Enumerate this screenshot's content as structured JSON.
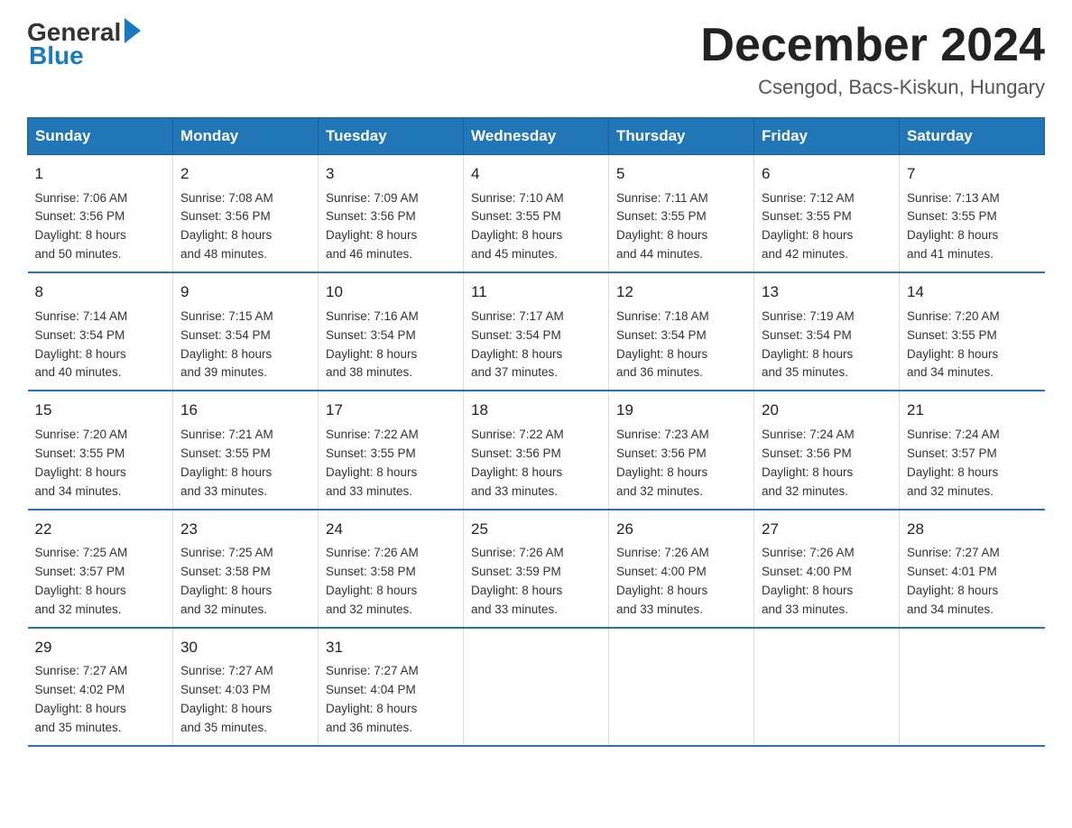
{
  "header": {
    "logo_general": "General",
    "logo_blue": "Blue",
    "main_title": "December 2024",
    "subtitle": "Csengod, Bacs-Kiskun, Hungary"
  },
  "days_of_week": [
    "Sunday",
    "Monday",
    "Tuesday",
    "Wednesday",
    "Thursday",
    "Friday",
    "Saturday"
  ],
  "weeks": [
    [
      {
        "day": "1",
        "info": "Sunrise: 7:06 AM\nSunset: 3:56 PM\nDaylight: 8 hours\nand 50 minutes."
      },
      {
        "day": "2",
        "info": "Sunrise: 7:08 AM\nSunset: 3:56 PM\nDaylight: 8 hours\nand 48 minutes."
      },
      {
        "day": "3",
        "info": "Sunrise: 7:09 AM\nSunset: 3:56 PM\nDaylight: 8 hours\nand 46 minutes."
      },
      {
        "day": "4",
        "info": "Sunrise: 7:10 AM\nSunset: 3:55 PM\nDaylight: 8 hours\nand 45 minutes."
      },
      {
        "day": "5",
        "info": "Sunrise: 7:11 AM\nSunset: 3:55 PM\nDaylight: 8 hours\nand 44 minutes."
      },
      {
        "day": "6",
        "info": "Sunrise: 7:12 AM\nSunset: 3:55 PM\nDaylight: 8 hours\nand 42 minutes."
      },
      {
        "day": "7",
        "info": "Sunrise: 7:13 AM\nSunset: 3:55 PM\nDaylight: 8 hours\nand 41 minutes."
      }
    ],
    [
      {
        "day": "8",
        "info": "Sunrise: 7:14 AM\nSunset: 3:54 PM\nDaylight: 8 hours\nand 40 minutes."
      },
      {
        "day": "9",
        "info": "Sunrise: 7:15 AM\nSunset: 3:54 PM\nDaylight: 8 hours\nand 39 minutes."
      },
      {
        "day": "10",
        "info": "Sunrise: 7:16 AM\nSunset: 3:54 PM\nDaylight: 8 hours\nand 38 minutes."
      },
      {
        "day": "11",
        "info": "Sunrise: 7:17 AM\nSunset: 3:54 PM\nDaylight: 8 hours\nand 37 minutes."
      },
      {
        "day": "12",
        "info": "Sunrise: 7:18 AM\nSunset: 3:54 PM\nDaylight: 8 hours\nand 36 minutes."
      },
      {
        "day": "13",
        "info": "Sunrise: 7:19 AM\nSunset: 3:54 PM\nDaylight: 8 hours\nand 35 minutes."
      },
      {
        "day": "14",
        "info": "Sunrise: 7:20 AM\nSunset: 3:55 PM\nDaylight: 8 hours\nand 34 minutes."
      }
    ],
    [
      {
        "day": "15",
        "info": "Sunrise: 7:20 AM\nSunset: 3:55 PM\nDaylight: 8 hours\nand 34 minutes."
      },
      {
        "day": "16",
        "info": "Sunrise: 7:21 AM\nSunset: 3:55 PM\nDaylight: 8 hours\nand 33 minutes."
      },
      {
        "day": "17",
        "info": "Sunrise: 7:22 AM\nSunset: 3:55 PM\nDaylight: 8 hours\nand 33 minutes."
      },
      {
        "day": "18",
        "info": "Sunrise: 7:22 AM\nSunset: 3:56 PM\nDaylight: 8 hours\nand 33 minutes."
      },
      {
        "day": "19",
        "info": "Sunrise: 7:23 AM\nSunset: 3:56 PM\nDaylight: 8 hours\nand 32 minutes."
      },
      {
        "day": "20",
        "info": "Sunrise: 7:24 AM\nSunset: 3:56 PM\nDaylight: 8 hours\nand 32 minutes."
      },
      {
        "day": "21",
        "info": "Sunrise: 7:24 AM\nSunset: 3:57 PM\nDaylight: 8 hours\nand 32 minutes."
      }
    ],
    [
      {
        "day": "22",
        "info": "Sunrise: 7:25 AM\nSunset: 3:57 PM\nDaylight: 8 hours\nand 32 minutes."
      },
      {
        "day": "23",
        "info": "Sunrise: 7:25 AM\nSunset: 3:58 PM\nDaylight: 8 hours\nand 32 minutes."
      },
      {
        "day": "24",
        "info": "Sunrise: 7:26 AM\nSunset: 3:58 PM\nDaylight: 8 hours\nand 32 minutes."
      },
      {
        "day": "25",
        "info": "Sunrise: 7:26 AM\nSunset: 3:59 PM\nDaylight: 8 hours\nand 33 minutes."
      },
      {
        "day": "26",
        "info": "Sunrise: 7:26 AM\nSunset: 4:00 PM\nDaylight: 8 hours\nand 33 minutes."
      },
      {
        "day": "27",
        "info": "Sunrise: 7:26 AM\nSunset: 4:00 PM\nDaylight: 8 hours\nand 33 minutes."
      },
      {
        "day": "28",
        "info": "Sunrise: 7:27 AM\nSunset: 4:01 PM\nDaylight: 8 hours\nand 34 minutes."
      }
    ],
    [
      {
        "day": "29",
        "info": "Sunrise: 7:27 AM\nSunset: 4:02 PM\nDaylight: 8 hours\nand 35 minutes."
      },
      {
        "day": "30",
        "info": "Sunrise: 7:27 AM\nSunset: 4:03 PM\nDaylight: 8 hours\nand 35 minutes."
      },
      {
        "day": "31",
        "info": "Sunrise: 7:27 AM\nSunset: 4:04 PM\nDaylight: 8 hours\nand 36 minutes."
      },
      {
        "day": "",
        "info": ""
      },
      {
        "day": "",
        "info": ""
      },
      {
        "day": "",
        "info": ""
      },
      {
        "day": "",
        "info": ""
      }
    ]
  ]
}
